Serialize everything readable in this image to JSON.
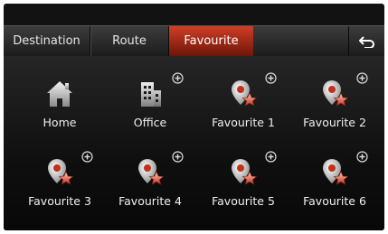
{
  "tabs": [
    {
      "label": "Destination",
      "active": false
    },
    {
      "label": "Route",
      "active": false
    },
    {
      "label": "Favourite",
      "active": true
    }
  ],
  "back_icon": "back-arrow-icon",
  "accent_color": "#b8301a",
  "items": [
    {
      "label": "Home",
      "icon": "home-icon",
      "has_add": false
    },
    {
      "label": "Office",
      "icon": "office-building-icon",
      "has_add": true
    },
    {
      "label": "Favourite 1",
      "icon": "favourite-pin-icon",
      "has_add": true
    },
    {
      "label": "Favourite 2",
      "icon": "favourite-pin-icon",
      "has_add": true
    },
    {
      "label": "Favourite 3",
      "icon": "favourite-pin-icon",
      "has_add": true
    },
    {
      "label": "Favourite 4",
      "icon": "favourite-pin-icon",
      "has_add": true
    },
    {
      "label": "Favourite 5",
      "icon": "favourite-pin-icon",
      "has_add": true
    },
    {
      "label": "Favourite 6",
      "icon": "favourite-pin-icon",
      "has_add": true
    }
  ]
}
